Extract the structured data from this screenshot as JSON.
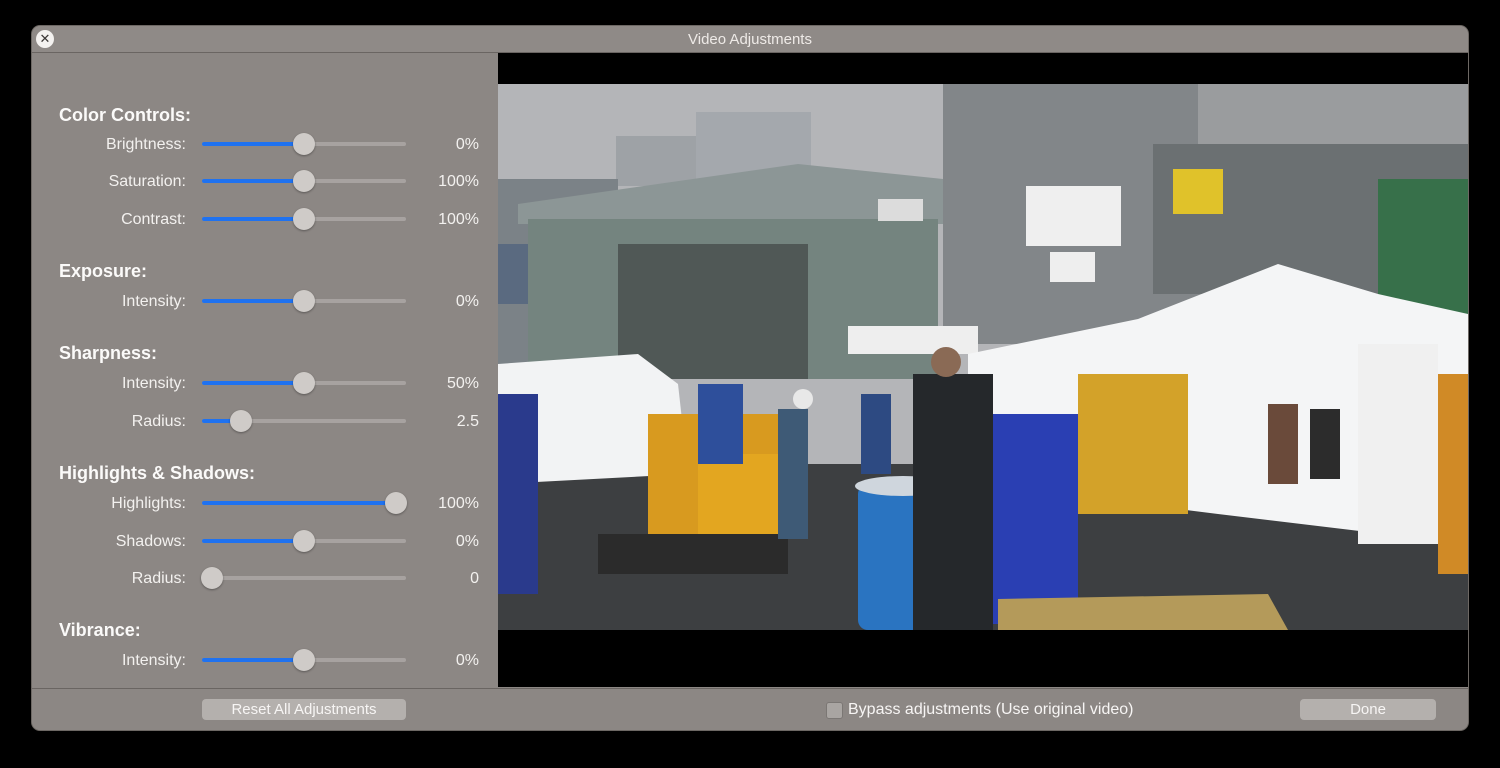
{
  "window": {
    "title": "Video Adjustments"
  },
  "icons": {
    "close": "close-icon"
  },
  "sections": [
    {
      "title": "Color Controls:",
      "controls": [
        {
          "label": "Brightness:",
          "value": "0%",
          "position": 0.5
        },
        {
          "label": "Saturation:",
          "value": "100%",
          "position": 0.5
        },
        {
          "label": "Contrast:",
          "value": "100%",
          "position": 0.5
        }
      ]
    },
    {
      "title": "Exposure:",
      "controls": [
        {
          "label": "Intensity:",
          "value": "0%",
          "position": 0.5
        }
      ]
    },
    {
      "title": "Sharpness:",
      "controls": [
        {
          "label": "Intensity:",
          "value": "50%",
          "position": 0.5
        },
        {
          "label": "Radius:",
          "value": "2.5",
          "position": 0.19
        }
      ]
    },
    {
      "title": "Highlights & Shadows:",
      "controls": [
        {
          "label": "Highlights:",
          "value": "100%",
          "position": 0.95
        },
        {
          "label": "Shadows:",
          "value": "0%",
          "position": 0.5
        },
        {
          "label": "Radius:",
          "value": "0",
          "position": 0.05
        }
      ]
    },
    {
      "title": "Vibrance:",
      "controls": [
        {
          "label": "Intensity:",
          "value": "0%",
          "position": 0.5
        }
      ]
    }
  ],
  "footer": {
    "reset_label": "Reset All Adjustments",
    "bypass_label": "Bypass adjustments (Use original video)",
    "bypass_checked": false,
    "done_label": "Done"
  },
  "colors": {
    "accent": "#1f72f0",
    "panel": "#8c8784",
    "thumb": "#cfcbc8"
  }
}
